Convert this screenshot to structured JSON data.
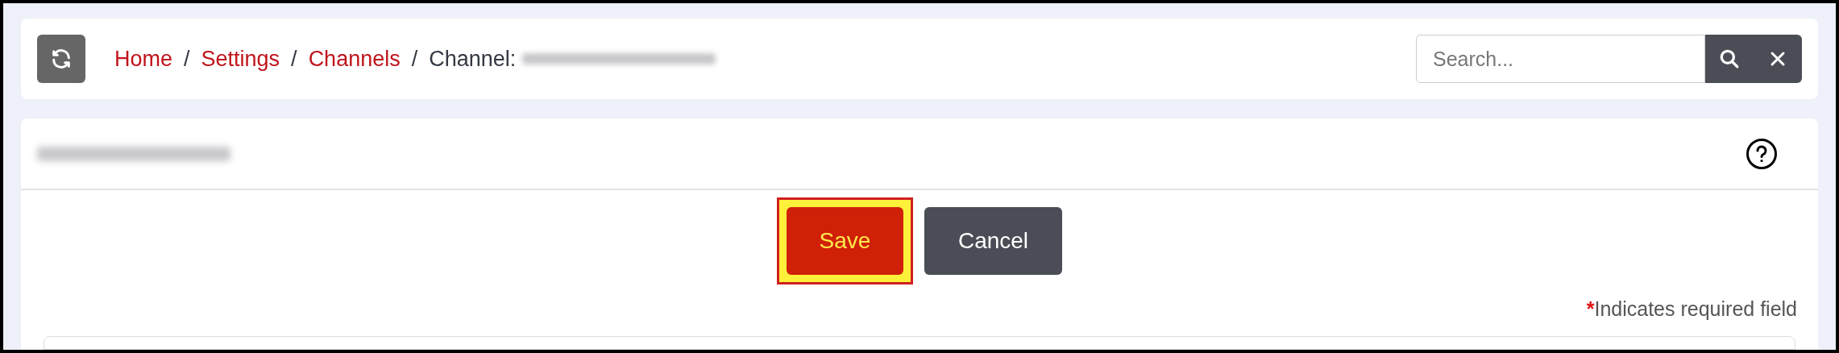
{
  "breadcrumb": [
    {
      "label": "Home",
      "kind": "link",
      "separator": "/"
    },
    {
      "label": "Settings",
      "kind": "link",
      "separator": "/"
    },
    {
      "label": "Channels",
      "kind": "link",
      "separator": "/"
    },
    {
      "label": "Channel:",
      "kind": "current"
    }
  ],
  "search": {
    "placeholder": "Search..."
  },
  "buttons": [
    {
      "label": "Save",
      "kind": "primary",
      "highlighted": true
    },
    {
      "label": "Cancel",
      "kind": "secondary",
      "highlighted": false
    }
  ],
  "required_note": {
    "mark": "*",
    "text": "Indicates required field"
  }
}
